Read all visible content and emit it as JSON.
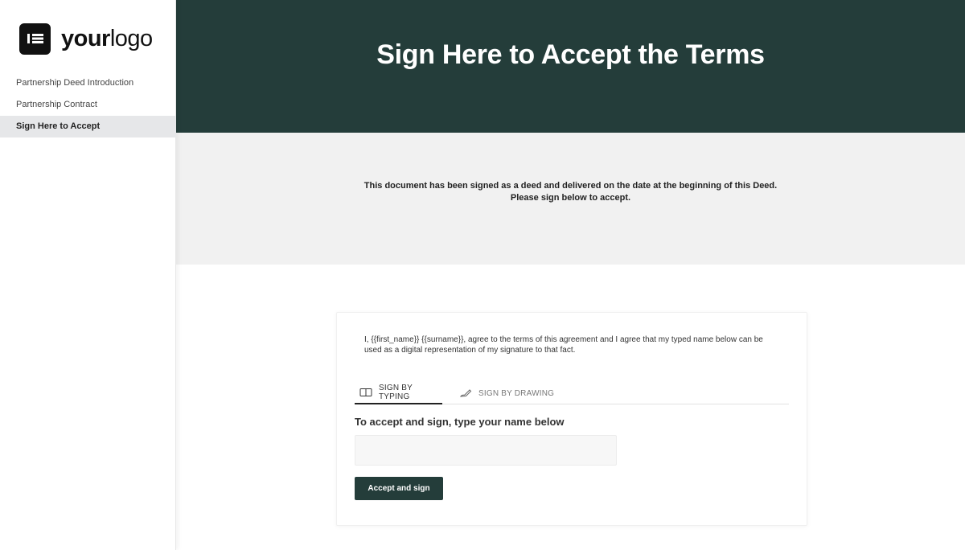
{
  "logo": {
    "icon": "logo-mark-icon",
    "text_bold": "your",
    "text_regular": "logo"
  },
  "sidebar": {
    "items": [
      {
        "label": "Partnership Deed Introduction",
        "active": false
      },
      {
        "label": "Partnership Contract",
        "active": false
      },
      {
        "label": "Sign Here to Accept",
        "active": true
      }
    ]
  },
  "header": {
    "title": "Sign Here to Accept the Terms"
  },
  "intro": {
    "line1": "This document has been signed as a deed and delivered on the date at the beginning of this Deed.",
    "line2": "Please sign below to accept."
  },
  "signature": {
    "agreement_text": "I, {{first_name}} {{surname}}, agree to the terms of this agreement and I agree that my typed name below can be used as a digital representation of my signature to that fact.",
    "tabs": [
      {
        "label": "SIGN BY TYPING",
        "icon": "keyboard-icon",
        "active": true
      },
      {
        "label": "SIGN BY DRAWING",
        "icon": "pen-icon",
        "active": false
      }
    ],
    "instruction": "To accept and sign, type your name below",
    "name_value": "",
    "name_placeholder": "",
    "button_label": "Accept and sign"
  },
  "colors": {
    "primary": "#243d3a",
    "intro_bg": "#f1f1f1",
    "active_nav_bg": "#e6e7e9",
    "white": "#ffffff"
  }
}
